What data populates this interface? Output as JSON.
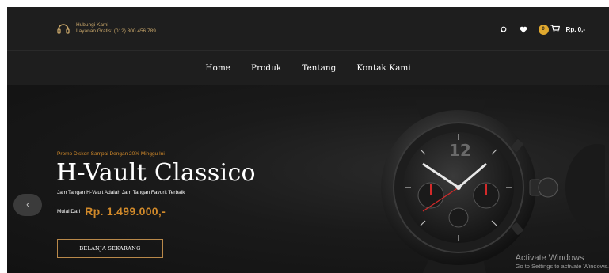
{
  "header": {
    "contact_title": "Hubungi Kami",
    "contact_line": "Layanan Gratis: (012) 800 456 789",
    "cart_count": "0",
    "cart_total": "Rp. 0,-"
  },
  "nav": {
    "items": [
      "Home",
      "Produk",
      "Tentang",
      "Kontak Kami"
    ]
  },
  "hero": {
    "promo": "Promo Diskon Sampai Dengan 20% Minggu Ini",
    "title": "H-Vault Classico",
    "subtitle": "Jam Tangan H-Vault Adalah Jam Tangan Favorit Terbaik",
    "price_label": "Mulai Dari",
    "price_value": "Rp. 1.499.000,-",
    "cta": "BELANJA SEKARANG",
    "prev_symbol": "‹"
  },
  "watch_dial": {
    "numeral": "12"
  },
  "watermark": {
    "title": "Activate Windows",
    "subtitle": "Go to Settings to activate Windows."
  },
  "colors": {
    "accent": "#d28a2a",
    "badge": "#e0a82e",
    "topbar": "#1e1e1e",
    "hero_bg": "#161616"
  },
  "icons": [
    "headset-icon",
    "search-icon",
    "heart-icon",
    "cart-icon",
    "chevron-left-icon"
  ]
}
